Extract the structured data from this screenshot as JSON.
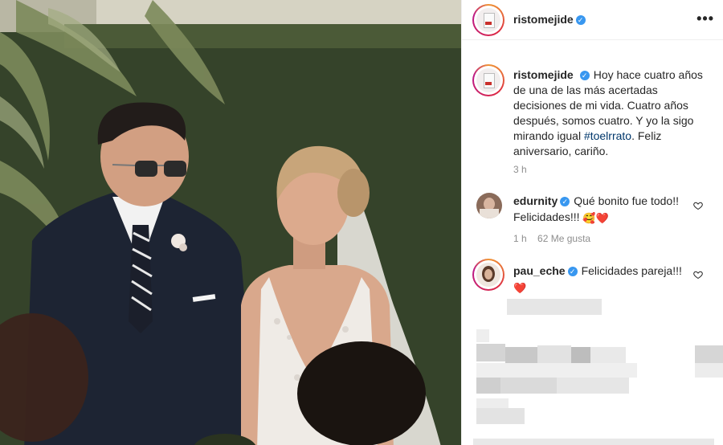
{
  "post": {
    "username": "ristomejide",
    "more_label": "•••"
  },
  "caption": {
    "username": "ristomejide",
    "text_1": "Hoy hace cuatro años de una de las más acertadas decisiones de mi vida. Cuatro años después, somos cuatro. Y yo la sigo mirando igual ",
    "hashtag": "#toelrrato",
    "text_2": ". Feliz aniversario, cariño.",
    "time": "3 h"
  },
  "comments": [
    {
      "username": "edurnity",
      "text": "Qué bonito fue todo!! Felicidades!!!",
      "emojis": "🥰❤️",
      "time": "1 h",
      "likes": "62 Me gusta"
    },
    {
      "username": "pau_eche",
      "text": "Felicidades pareja!!!",
      "emojis": "❤️"
    }
  ],
  "colors": {
    "verified": "#3897f0",
    "hashtag": "#00376b",
    "muted": "#8e8e8e"
  },
  "icons": [
    "verified-icon",
    "more-options-icon",
    "heart-icon"
  ]
}
